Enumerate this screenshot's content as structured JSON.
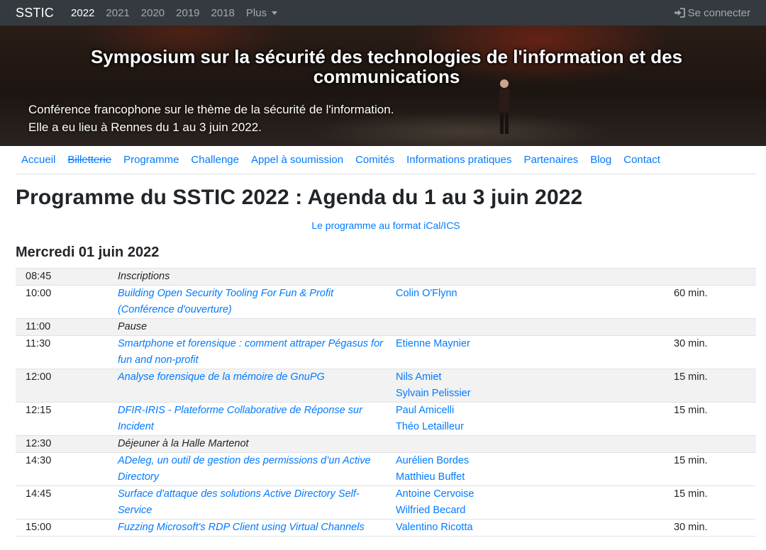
{
  "navbar": {
    "brand": "SSTIC",
    "years": [
      "2022",
      "2021",
      "2020",
      "2019",
      "2018"
    ],
    "more_label": "Plus",
    "login_label": "Se connecter"
  },
  "hero": {
    "title": "Symposium sur la sécurité des technologies de l'information et des communications",
    "subtitle_line1": "Conférence francophone sur le thème de la sécurité de l'information.",
    "subtitle_line2": "Elle a eu lieu à Rennes du 1 au 3 juin 2022."
  },
  "subnav": [
    {
      "label": "Accueil",
      "struck": false
    },
    {
      "label": "Billetterie",
      "struck": true
    },
    {
      "label": "Programme",
      "struck": false
    },
    {
      "label": "Challenge",
      "struck": false
    },
    {
      "label": "Appel à soumission",
      "struck": false
    },
    {
      "label": "Comités",
      "struck": false
    },
    {
      "label": "Informations pratiques",
      "struck": false
    },
    {
      "label": "Partenaires",
      "struck": false
    },
    {
      "label": "Blog",
      "struck": false
    },
    {
      "label": "Contact",
      "struck": false
    }
  ],
  "page_title": "Programme du SSTIC 2022 : Agenda du 1 au 3 juin 2022",
  "ical_link": "Le programme au format iCal/ICS",
  "day_title": "Mercredi 01 juin 2022",
  "schedule": [
    {
      "time": "08:45",
      "title": "Inscriptions",
      "link": false,
      "speakers": [],
      "duration": ""
    },
    {
      "time": "10:00",
      "title": "Building Open Security Tooling For Fun & Profit (Conférence d'ouverture)",
      "link": true,
      "speakers": [
        "Colin O'Flynn"
      ],
      "duration": "60 min."
    },
    {
      "time": "11:00",
      "title": "Pause",
      "link": false,
      "speakers": [],
      "duration": ""
    },
    {
      "time": "11:30",
      "title": "Smartphone et forensique : comment attraper Pégasus for fun and non-profit",
      "link": true,
      "speakers": [
        "Etienne Maynier"
      ],
      "duration": "30 min."
    },
    {
      "time": "12:00",
      "title": "Analyse forensique de la mémoire de GnuPG",
      "link": true,
      "speakers": [
        "Nils Amiet",
        "Sylvain Pelissier"
      ],
      "duration": "15 min."
    },
    {
      "time": "12:15",
      "title": "DFIR-IRIS - Plateforme Collaborative de Réponse sur Incident",
      "link": true,
      "speakers": [
        "Paul Amicelli",
        "Théo Letailleur"
      ],
      "duration": "15 min."
    },
    {
      "time": "12:30",
      "title": "Déjeuner à la Halle Martenot",
      "link": false,
      "speakers": [],
      "duration": ""
    },
    {
      "time": "14:30",
      "title": "ADeleg, un outil de gestion des permissions d’un Active Directory",
      "link": true,
      "speakers": [
        "Aurélien Bordes",
        "Matthieu Buffet"
      ],
      "duration": "15 min."
    },
    {
      "time": "14:45",
      "title": "Surface d'attaque des solutions Active Directory Self-Service",
      "link": true,
      "speakers": [
        "Antoine Cervoise",
        "Wilfried Becard"
      ],
      "duration": "15 min."
    },
    {
      "time": "15:00",
      "title": "Fuzzing Microsoft's RDP Client using Virtual Channels",
      "link": true,
      "speakers": [
        "Valentino Ricotta"
      ],
      "duration": "30 min."
    }
  ],
  "colors": {
    "navbar_bg": "#343a40",
    "link": "#007bff",
    "row_stripe": "#f2f2f2"
  },
  "icons": {
    "login": "sign-in-icon",
    "more": "caret-down-icon"
  }
}
